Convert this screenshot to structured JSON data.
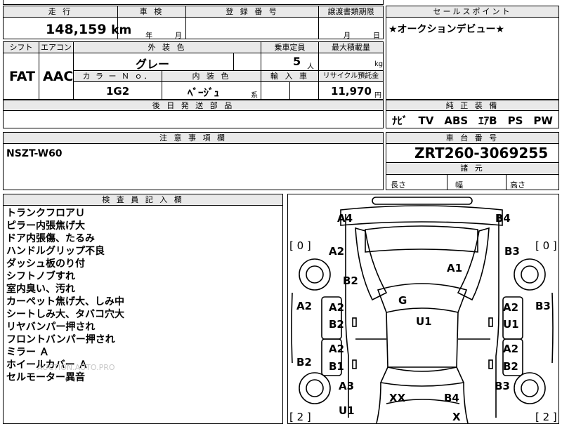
{
  "header": {
    "mileage_label": "走 行",
    "inspection_label": "車 検",
    "registration_label": "登 録 番 号",
    "transfer_deadline_label": "譲渡書類期限",
    "sale_point_label": "セールスポイント"
  },
  "mileage": {
    "value": "148,159",
    "unit": "km"
  },
  "inspection": {
    "year_unit": "年",
    "month_unit": "月"
  },
  "transfer": {
    "month_unit": "月",
    "day_unit": "日"
  },
  "sale_point": {
    "text": "★オークションデビュー★"
  },
  "spec_labels": {
    "shift": "シフト",
    "aircon": "エアコン",
    "exterior_color": "外 装 色",
    "capacity": "乗車定員",
    "max_load": "最大積載量",
    "color_no": "カ ラ ー Ｎ ｏ．",
    "interior_color": "内 装 色",
    "import": "輸 入 車",
    "recycle_fee": "リサイクル預託金"
  },
  "specs": {
    "shift": "FAT",
    "aircon": "AAC",
    "exterior_color": "グレー",
    "capacity": "5",
    "capacity_unit": "人",
    "load_unit": "kg",
    "color_no": "1G2",
    "interior_color": "ﾍﾞｰｼﾞｭ",
    "interior_suffix": "系",
    "recycle_fee": "11,970",
    "recycle_unit": "円"
  },
  "later_parts_label": "後 日 発 送 部 品",
  "equipment": {
    "label": "純 正 装 備",
    "items": "ﾅﾋﾞ　TV　ABS　ｴｱB　PS　PW"
  },
  "caution": {
    "label": "注 意 事 項 欄",
    "text": "NSZT-W60"
  },
  "chassis": {
    "label": "車 台 番 号",
    "number": "ZRT260-3069255"
  },
  "dimensions": {
    "label": "諸 元",
    "length": "長さ",
    "width": "幅",
    "height": "高さ"
  },
  "inspector": {
    "label": "検 査 員 記 入 欄",
    "notes": [
      "トランクフロアＵ",
      "ピラー内張焦げ大",
      "ドア内張傷、たるみ",
      "ハンドルグリップ不良",
      "ダッシュ板のり付",
      "シフトノブすれ",
      "室内臭い、汚れ",
      "カーペット焦げ大、しみ中",
      "シートしみ大、タバコ穴大",
      "リヤバンパー押され",
      "フロントバンパー押され",
      "ミラー Ａ",
      "ホイールカバー Ａ",
      "セルモーター異音"
    ],
    "watermark": "AUCTION.AUTO.PRO"
  },
  "diagram": {
    "marks": {
      "tl_a4": "A4",
      "tr_b4": "B4",
      "l_a2_top": "A2",
      "r_b3_top": "B3",
      "b2_fender": "B2",
      "a1_hood": "A1",
      "g_glass": "G",
      "u1_roof": "U1",
      "l_a2_side": "A2",
      "r_b3_side": "B3",
      "ld_a2": "A2",
      "ld_b2": "B2",
      "rd_a2": "A2",
      "rd_u1": "U1",
      "lr_a2": "A2",
      "lr_b1": "B1",
      "rr_a2": "A2",
      "rr_b2": "B2",
      "l_b2_rocker": "B2",
      "l_a3": "A3",
      "r_b3_bot": "B3",
      "xx": "XX",
      "b4_trunk": "B4",
      "u1_bot": "U1",
      "x_bot": "X"
    },
    "tire_tl": "[ 0 ]",
    "tire_tr": "[ 0 ]",
    "tire_bl": "[ 2 ]",
    "tire_br": "[ 2 ]"
  }
}
